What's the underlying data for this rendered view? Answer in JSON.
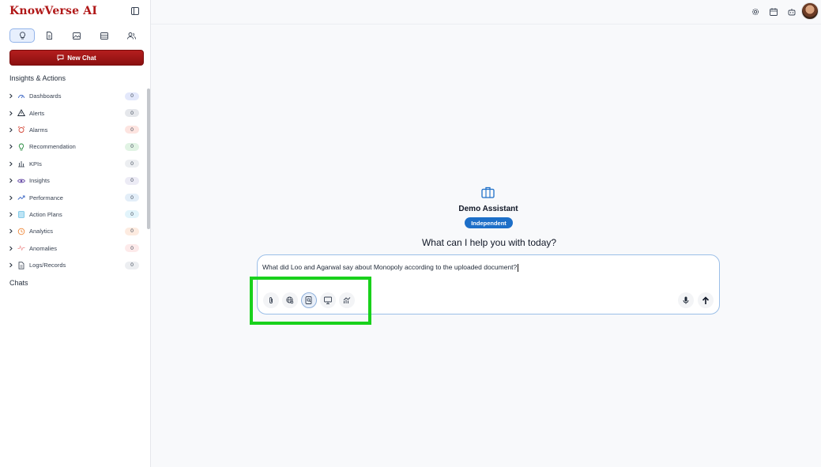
{
  "app": {
    "title": "KnowVerse AI"
  },
  "sidebar": {
    "new_chat_label": "New Chat",
    "section_title": "Insights & Actions",
    "chats_title": "Chats",
    "tabs": [
      {
        "icon": "lightbulb-icon",
        "active": true
      },
      {
        "icon": "document-icon",
        "active": false
      },
      {
        "icon": "image-icon",
        "active": false
      },
      {
        "icon": "database-icon",
        "active": false
      },
      {
        "icon": "users-icon",
        "active": false
      }
    ],
    "items": [
      {
        "label": "Dashboards",
        "icon": "gauge-icon",
        "count": "0",
        "badge_color": "#e3e8fb"
      },
      {
        "label": "Alerts",
        "icon": "warning-icon",
        "count": "0",
        "badge_color": "#e5e7eb"
      },
      {
        "label": "Alarms",
        "icon": "alarm-icon",
        "count": "0",
        "badge_color": "#fde4e0"
      },
      {
        "label": "Recommendation",
        "icon": "lightbulb-icon",
        "count": "0",
        "badge_color": "#e1f3e4"
      },
      {
        "label": "KPIs",
        "icon": "bar-chart-icon",
        "count": "0",
        "badge_color": "#eceef1"
      },
      {
        "label": "Insights",
        "icon": "eye-icon",
        "count": "0",
        "badge_color": "#ecebf5"
      },
      {
        "label": "Performance",
        "icon": "trend-up-icon",
        "count": "0",
        "badge_color": "#e3eef8"
      },
      {
        "label": "Action Plans",
        "icon": "clipboard-icon",
        "count": "0",
        "badge_color": "#e2f4fb"
      },
      {
        "label": "Analytics",
        "icon": "clock-icon",
        "count": "0",
        "badge_color": "#fdebe0"
      },
      {
        "label": "Anomalies",
        "icon": "pulse-icon",
        "count": "0",
        "badge_color": "#fdeaea"
      },
      {
        "label": "Logs/Records",
        "icon": "file-icon",
        "count": "0",
        "badge_color": "#eceef1"
      }
    ]
  },
  "topbar": {
    "icons": [
      "settings-icon",
      "calendar-icon",
      "robot-icon"
    ]
  },
  "main": {
    "assistant_name": "Demo Assistant",
    "assistant_mode": "Independent",
    "prompt": "What can I help you with today?",
    "input_value": "What did Loo and Agarwal say about Monopoly according to the uploaded document?",
    "tools": [
      "attach-icon",
      "web-search-icon",
      "document-search-icon",
      "presentation-icon",
      "chart-icon"
    ],
    "actions": [
      "microphone-icon",
      "send-icon"
    ]
  },
  "colors": {
    "brand": "#b01717",
    "accent": "#1d6fc8",
    "highlight": "#19d11c"
  }
}
